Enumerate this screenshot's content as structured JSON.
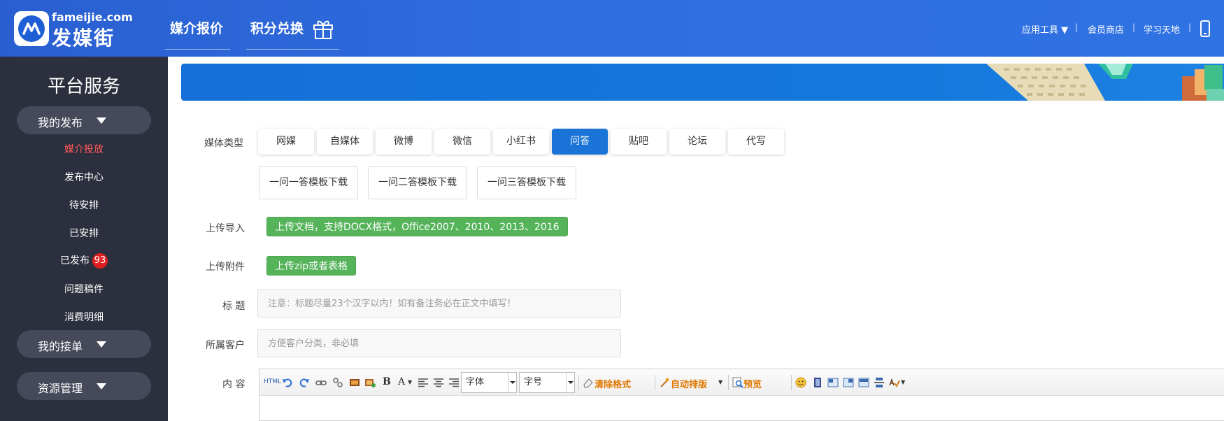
{
  "header": {
    "brand_en": "fameijie.com",
    "brand_cn": "发媒街",
    "nav": [
      "媒介报价",
      "积分兑换"
    ],
    "links": [
      "应用工具 ▼",
      "会员商店",
      "学习天地"
    ]
  },
  "sidebar": {
    "title": "平台服务",
    "groups": [
      "我的发布",
      "我的接单",
      "资源管理"
    ],
    "items": [
      "媒介投放",
      "发布中心",
      "待安排",
      "已安排",
      "已发布",
      "问题稿件",
      "消费明细"
    ],
    "published_count": "93"
  },
  "form": {
    "media_type_label": "媒体类型",
    "media_types": [
      "网媒",
      "自媒体",
      "微博",
      "微信",
      "小红书",
      "问答",
      "贴吧",
      "论坛",
      "代写"
    ],
    "active_media_type": "问答",
    "templates": [
      "一问一答模板下载",
      "一问二答模板下载",
      "一问三答模板下载"
    ],
    "upload_import_label": "上传导入",
    "upload_doc_button": "上传文档，支持DOCX格式，Office2007、2010、2013、2016",
    "upload_attach_label": "上传附件",
    "upload_zip_button": "上传zip或者表格",
    "title_label": "标 题",
    "title_placeholder": "注意：标题尽量23个汉字以内！如有备注务必在正文中填写！",
    "client_label": "所属客户",
    "client_placeholder": "方便客户分类，非必填",
    "content_label": "内 容"
  },
  "editor": {
    "html_label": "HTML",
    "bold_label": "B",
    "fontcolor_label": "A",
    "font_select": "字体",
    "size_select": "字号",
    "clear_format": "清除格式",
    "auto_layout": "自动排版",
    "preview": "预览"
  },
  "colors": {
    "header": "#2e6fe0",
    "sidebar": "#2c2f3d",
    "accent": "#1a73d6",
    "green": "#55b35a",
    "badge": "#e02020",
    "active_side": "#ff5a5a"
  }
}
